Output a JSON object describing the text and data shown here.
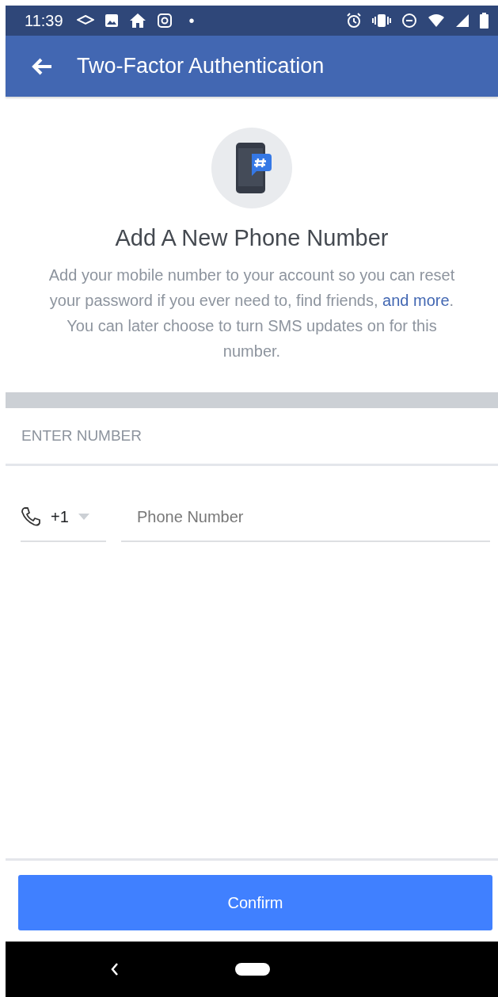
{
  "status_bar": {
    "time": "11:39",
    "dot": "•"
  },
  "app_bar": {
    "title": "Two-Factor Authentication"
  },
  "intro": {
    "title": "Add A New Phone Number",
    "before": "Add your mobile number to your account so you can reset your password if you ever need to, find friends, ",
    "link": "and more",
    "after": ". You can later choose to turn SMS updates on for this number."
  },
  "section": {
    "label": "ENTER NUMBER"
  },
  "form": {
    "country_code": "+1",
    "phone_placeholder": "Phone Number"
  },
  "buttons": [
    {
      "label": "Confirm"
    }
  ]
}
